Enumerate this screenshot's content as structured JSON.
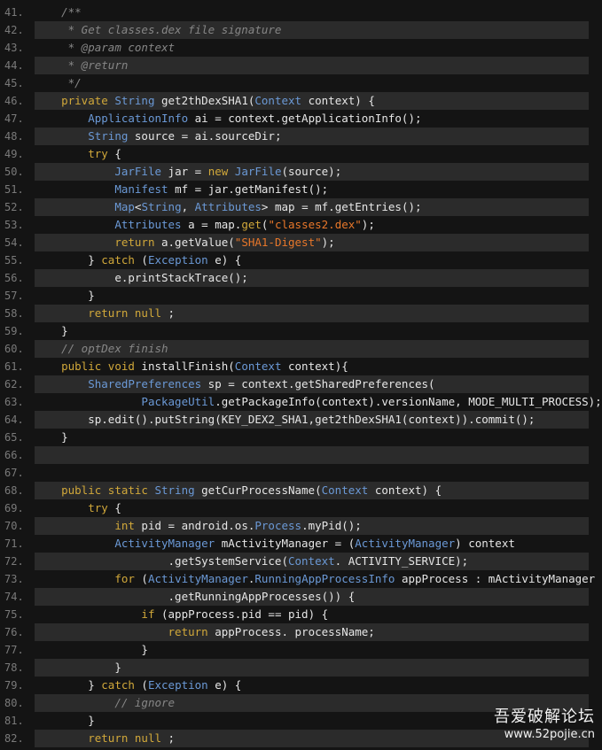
{
  "code": {
    "lines": [
      {
        "n": "41.",
        "t": [
          [
            "cm",
            "/**"
          ]
        ]
      },
      {
        "n": "42.",
        "t": [
          [
            "cm",
            " * Get classes.dex file signature"
          ]
        ]
      },
      {
        "n": "43.",
        "t": [
          [
            "cm",
            " * @param context"
          ]
        ]
      },
      {
        "n": "44.",
        "t": [
          [
            "cm",
            " * @return"
          ]
        ]
      },
      {
        "n": "45.",
        "t": [
          [
            "cm",
            " */"
          ]
        ]
      },
      {
        "n": "46.",
        "t": [
          [
            "kw",
            "private "
          ],
          [
            "ty",
            "String"
          ],
          [
            "",
            " get2thDexSHA1("
          ],
          [
            "ty",
            "Context"
          ],
          [
            "",
            " context) {"
          ]
        ]
      },
      {
        "n": "47.",
        "t": [
          [
            "",
            "    "
          ],
          [
            "ty",
            "ApplicationInfo"
          ],
          [
            "",
            " ai = context.getApplicationInfo();"
          ]
        ]
      },
      {
        "n": "48.",
        "t": [
          [
            "",
            "    "
          ],
          [
            "ty",
            "String"
          ],
          [
            "",
            " source = ai.sourceDir;"
          ]
        ]
      },
      {
        "n": "49.",
        "t": [
          [
            "",
            "    "
          ],
          [
            "kw",
            "try"
          ],
          [
            "",
            " {"
          ]
        ]
      },
      {
        "n": "50.",
        "t": [
          [
            "",
            "        "
          ],
          [
            "ty",
            "JarFile"
          ],
          [
            "",
            " jar = "
          ],
          [
            "kw",
            "new "
          ],
          [
            "ty",
            "JarFile"
          ],
          [
            "",
            "(source);"
          ]
        ]
      },
      {
        "n": "51.",
        "t": [
          [
            "",
            "        "
          ],
          [
            "ty",
            "Manifest"
          ],
          [
            "",
            " mf = jar.getManifest();"
          ]
        ]
      },
      {
        "n": "52.",
        "t": [
          [
            "",
            "        "
          ],
          [
            "ty",
            "Map"
          ],
          [
            "",
            "<"
          ],
          [
            "ty",
            "String"
          ],
          [
            "",
            ", "
          ],
          [
            "ty",
            "Attributes"
          ],
          [
            "",
            "> map = mf.getEntries();"
          ]
        ]
      },
      {
        "n": "53.",
        "t": [
          [
            "",
            "        "
          ],
          [
            "ty",
            "Attributes"
          ],
          [
            "",
            " a = map."
          ],
          [
            "kw",
            "get"
          ],
          [
            "",
            "("
          ],
          [
            "st",
            "\"classes2.dex\""
          ],
          [
            "",
            ");"
          ]
        ]
      },
      {
        "n": "54.",
        "t": [
          [
            "",
            "        "
          ],
          [
            "kw",
            "return"
          ],
          [
            "",
            " a.getValue("
          ],
          [
            "st",
            "\"SHA1-Digest\""
          ],
          [
            "",
            ");"
          ]
        ]
      },
      {
        "n": "55.",
        "t": [
          [
            "",
            "    } "
          ],
          [
            "kw",
            "catch"
          ],
          [
            "",
            " ("
          ],
          [
            "ty",
            "Exception"
          ],
          [
            "",
            " e) {"
          ]
        ]
      },
      {
        "n": "56.",
        "t": [
          [
            "",
            "        e.printStackTrace();"
          ]
        ]
      },
      {
        "n": "57.",
        "t": [
          [
            "",
            "    }"
          ]
        ]
      },
      {
        "n": "58.",
        "t": [
          [
            "",
            "    "
          ],
          [
            "kw",
            "return null"
          ],
          [
            "",
            " ;"
          ]
        ]
      },
      {
        "n": "59.",
        "t": [
          [
            "",
            "}"
          ]
        ]
      },
      {
        "n": "60.",
        "t": [
          [
            "cm",
            "// optDex finish"
          ]
        ]
      },
      {
        "n": "61.",
        "t": [
          [
            "kw",
            "public void"
          ],
          [
            "",
            " installFinish("
          ],
          [
            "ty",
            "Context"
          ],
          [
            "",
            " context){"
          ]
        ]
      },
      {
        "n": "62.",
        "t": [
          [
            "",
            "    "
          ],
          [
            "ty",
            "SharedPreferences"
          ],
          [
            "",
            " sp = context.getSharedPreferences("
          ]
        ]
      },
      {
        "n": "63.",
        "t": [
          [
            "",
            "            "
          ],
          [
            "ty",
            "PackageUtil"
          ],
          [
            "",
            ".getPackageInfo(context).versionName, MODE_MULTI_PROCESS);"
          ]
        ]
      },
      {
        "n": "64.",
        "t": [
          [
            "",
            "    sp.edit().putString(KEY_DEX2_SHA1,get2thDexSHA1(context)).commit();"
          ]
        ]
      },
      {
        "n": "65.",
        "t": [
          [
            "",
            "}"
          ]
        ]
      },
      {
        "n": "66.",
        "t": [
          [
            "",
            ""
          ]
        ]
      },
      {
        "n": "67.",
        "t": [
          [
            "",
            ""
          ]
        ]
      },
      {
        "n": "68.",
        "t": [
          [
            "kw",
            "public static "
          ],
          [
            "ty",
            "String"
          ],
          [
            "",
            " getCurProcessName("
          ],
          [
            "ty",
            "Context"
          ],
          [
            "",
            " context) {"
          ]
        ]
      },
      {
        "n": "69.",
        "t": [
          [
            "",
            "    "
          ],
          [
            "kw",
            "try"
          ],
          [
            "",
            " {"
          ]
        ]
      },
      {
        "n": "70.",
        "t": [
          [
            "",
            "        "
          ],
          [
            "kw",
            "int"
          ],
          [
            "",
            " pid = android.os."
          ],
          [
            "ty",
            "Process"
          ],
          [
            "",
            ".myPid();"
          ]
        ]
      },
      {
        "n": "71.",
        "t": [
          [
            "",
            "        "
          ],
          [
            "ty",
            "ActivityManager"
          ],
          [
            "",
            " mActivityManager = ("
          ],
          [
            "ty",
            "ActivityManager"
          ],
          [
            "",
            ") context"
          ]
        ]
      },
      {
        "n": "72.",
        "t": [
          [
            "",
            "                .getSystemService("
          ],
          [
            "ty",
            "Context"
          ],
          [
            "",
            ". ACTIVITY_SERVICE);"
          ]
        ]
      },
      {
        "n": "73.",
        "t": [
          [
            "",
            "        "
          ],
          [
            "kw",
            "for"
          ],
          [
            "",
            " ("
          ],
          [
            "ty",
            "ActivityManager"
          ],
          [
            "",
            "."
          ],
          [
            "ty",
            "RunningAppProcessInfo"
          ],
          [
            "",
            " appProcess : mActivityManager"
          ]
        ]
      },
      {
        "n": "74.",
        "t": [
          [
            "",
            "                .getRunningAppProcesses()) {"
          ]
        ]
      },
      {
        "n": "75.",
        "t": [
          [
            "",
            "            "
          ],
          [
            "kw",
            "if"
          ],
          [
            "",
            " (appProcess.pid == pid) {"
          ]
        ]
      },
      {
        "n": "76.",
        "t": [
          [
            "",
            "                "
          ],
          [
            "kw",
            "return"
          ],
          [
            "",
            " appProcess. processName;"
          ]
        ]
      },
      {
        "n": "77.",
        "t": [
          [
            "",
            "            }"
          ]
        ]
      },
      {
        "n": "78.",
        "t": [
          [
            "",
            "        }"
          ]
        ]
      },
      {
        "n": "79.",
        "t": [
          [
            "",
            "    } "
          ],
          [
            "kw",
            "catch"
          ],
          [
            "",
            " ("
          ],
          [
            "ty",
            "Exception"
          ],
          [
            "",
            " e) {"
          ]
        ]
      },
      {
        "n": "80.",
        "t": [
          [
            "",
            "        "
          ],
          [
            "cm",
            "// ignore"
          ]
        ]
      },
      {
        "n": "81.",
        "t": [
          [
            "",
            "    }"
          ]
        ]
      },
      {
        "n": "82.",
        "t": [
          [
            "",
            "    "
          ],
          [
            "kw",
            "return null"
          ],
          [
            "",
            " ;"
          ]
        ]
      }
    ]
  },
  "watermark": {
    "name": "吾爱破解论坛",
    "url": "www.52pojie.cn"
  },
  "colors": {
    "background": "#141414",
    "stripe": "#2b2b2b",
    "comment": "#868686",
    "keyword": "#d1a83a",
    "type": "#6b99d6",
    "string": "#e8772a",
    "text": "#e6e6e6"
  }
}
